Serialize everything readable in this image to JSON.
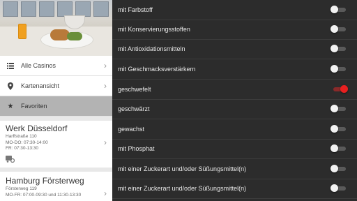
{
  "nav": {
    "items": [
      {
        "label": "Alle Casinos",
        "icon": "list-icon"
      },
      {
        "label": "Kartenansicht",
        "icon": "map-pin-icon"
      },
      {
        "label": "Favoriten",
        "icon": "star-icon"
      }
    ]
  },
  "casinos": [
    {
      "name": "Werk Düsseldorf",
      "street": "Harffstraße 110",
      "hours1": "MO-DO: 07:30-14:00",
      "hours2": "FR: 07:30-13:30"
    },
    {
      "name": "Hamburg Försterweg",
      "street": "Försterweg 119",
      "hours1": "MO-FR: 07:00-09:30 und 11:30-13:30"
    }
  ],
  "filters": [
    {
      "label": "mit Farbstoff",
      "on": false
    },
    {
      "label": "mit Konservierungsstoffen",
      "on": false
    },
    {
      "label": "mit Antioxidationsmitteln",
      "on": false
    },
    {
      "label": "mit Geschmacksverstärkern",
      "on": false
    },
    {
      "label": "geschwefelt",
      "on": true
    },
    {
      "label": "geschwärzt",
      "on": false
    },
    {
      "label": "gewachst",
      "on": false
    },
    {
      "label": "mit Phosphat",
      "on": false
    },
    {
      "label": "mit einer Zuckerart und/oder Süßungsmittel(n)",
      "on": false
    },
    {
      "label": "mit einer Zuckerart und/oder Süßungsmittel(n)",
      "on": false
    }
  ],
  "colors": {
    "accent": "#e82020",
    "selected_nav": "#b3b3b3",
    "right_bg": "#2c2c2c"
  }
}
